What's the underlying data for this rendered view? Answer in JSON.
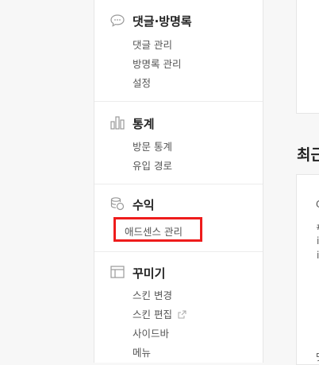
{
  "sidebar": {
    "sections": [
      {
        "icon": "speech-bubble-icon",
        "title": "댓글·방명록",
        "items": [
          "댓글 관리",
          "방명록 관리",
          "설정"
        ]
      },
      {
        "icon": "bar-chart-icon",
        "title": "통계",
        "items": [
          "방문 통계",
          "유입 경로"
        ]
      },
      {
        "icon": "coins-icon",
        "title": "수익",
        "items": [
          "애드센스 관리"
        ]
      },
      {
        "icon": "layout-icon",
        "title": "꾸미기",
        "items": [
          "스킨 변경",
          "스킨 편집",
          "사이드바",
          "메뉴"
        ]
      }
    ]
  },
  "main": {
    "recent_title": "최근",
    "card_fragments": [
      "C",
      "#",
      "i",
      "i",
      "댓"
    ]
  },
  "colors": {
    "highlight": "#ee1c1c",
    "icon": "#999999"
  }
}
